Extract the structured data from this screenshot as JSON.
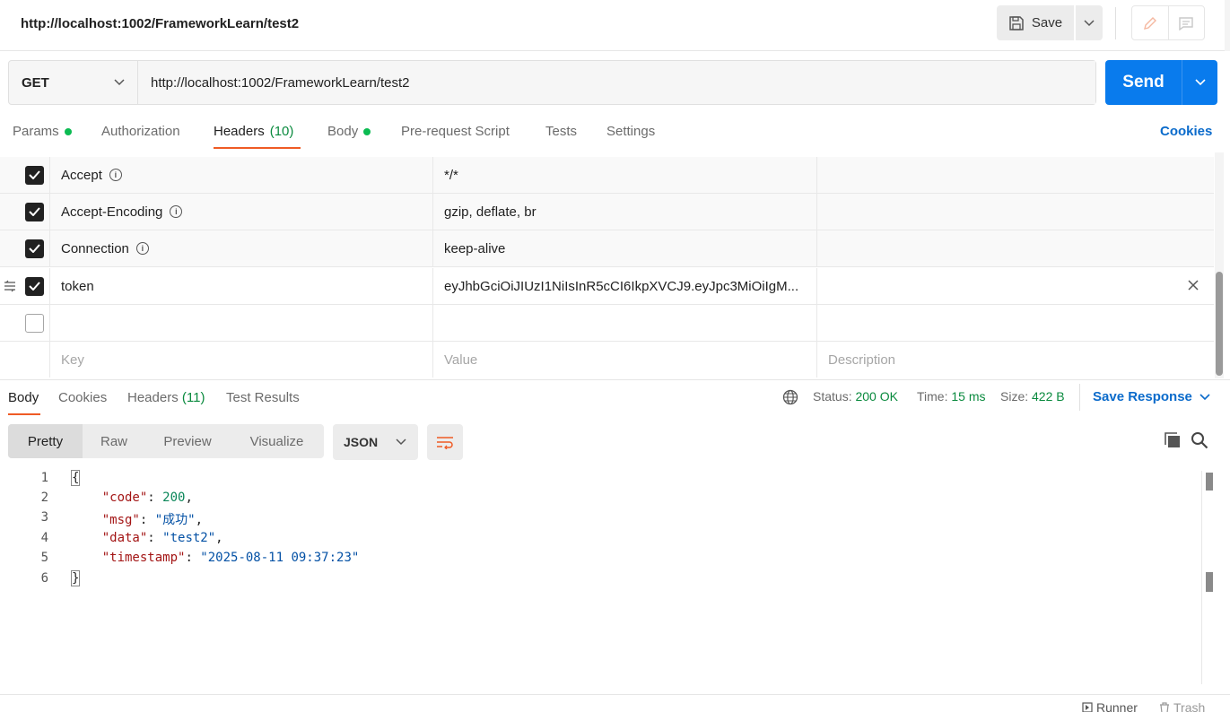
{
  "titlebar": {
    "title": "http://localhost:1002/FrameworkLearn/test2",
    "save_label": "Save"
  },
  "request": {
    "method": "GET",
    "url": "http://localhost:1002/FrameworkLearn/test2",
    "send_label": "Send"
  },
  "req_tabs": {
    "params": "Params",
    "authorization": "Authorization",
    "headers": "Headers",
    "headers_count": "(10)",
    "body": "Body",
    "prerequest": "Pre-request Script",
    "tests": "Tests",
    "settings": "Settings",
    "cookies": "Cookies"
  },
  "headers": {
    "rows": [
      {
        "key": "Accept",
        "value": "*/*",
        "checked": true
      },
      {
        "key": "Accept-Encoding",
        "value": "gzip, deflate, br",
        "checked": true
      },
      {
        "key": "Connection",
        "value": "keep-alive",
        "checked": true
      },
      {
        "key": "token",
        "value": "eyJhbGciOiJIUzI1NiIsInR5cCI6IkpXVCJ9.eyJpc3MiOiIgM...",
        "checked": true
      }
    ],
    "key_placeholder": "Key",
    "value_placeholder": "Value",
    "desc_placeholder": "Description"
  },
  "response": {
    "tabs": {
      "body": "Body",
      "cookies": "Cookies",
      "headers": "Headers",
      "headers_count": "(11)",
      "test_results": "Test Results"
    },
    "status_label": "Status:",
    "status_value": "200 OK",
    "time_label": "Time:",
    "time_value": "15 ms",
    "size_label": "Size:",
    "size_value": "422 B",
    "save_response": "Save Response",
    "views": [
      "Pretty",
      "Raw",
      "Preview",
      "Visualize"
    ],
    "format": "JSON",
    "code": {
      "l1": "{",
      "code_key": "\"code\"",
      "code_val": "200",
      "msg_key": "\"msg\"",
      "msg_val": "\"成功\"",
      "data_key": "\"data\"",
      "data_val": "\"test2\"",
      "ts_key": "\"timestamp\"",
      "ts_val": "\"2025-08-11 09:37:23\"",
      "l6": "}"
    },
    "line_numbers": [
      "1",
      "2",
      "3",
      "4",
      "5",
      "6"
    ]
  },
  "footer": {
    "runner": "Runner",
    "trash": "Trash"
  },
  "colors": {
    "accent": "#ef5b25",
    "send_blue": "#097bed",
    "link_blue": "#0b6bcb",
    "status_green": "#0a8a3e"
  }
}
